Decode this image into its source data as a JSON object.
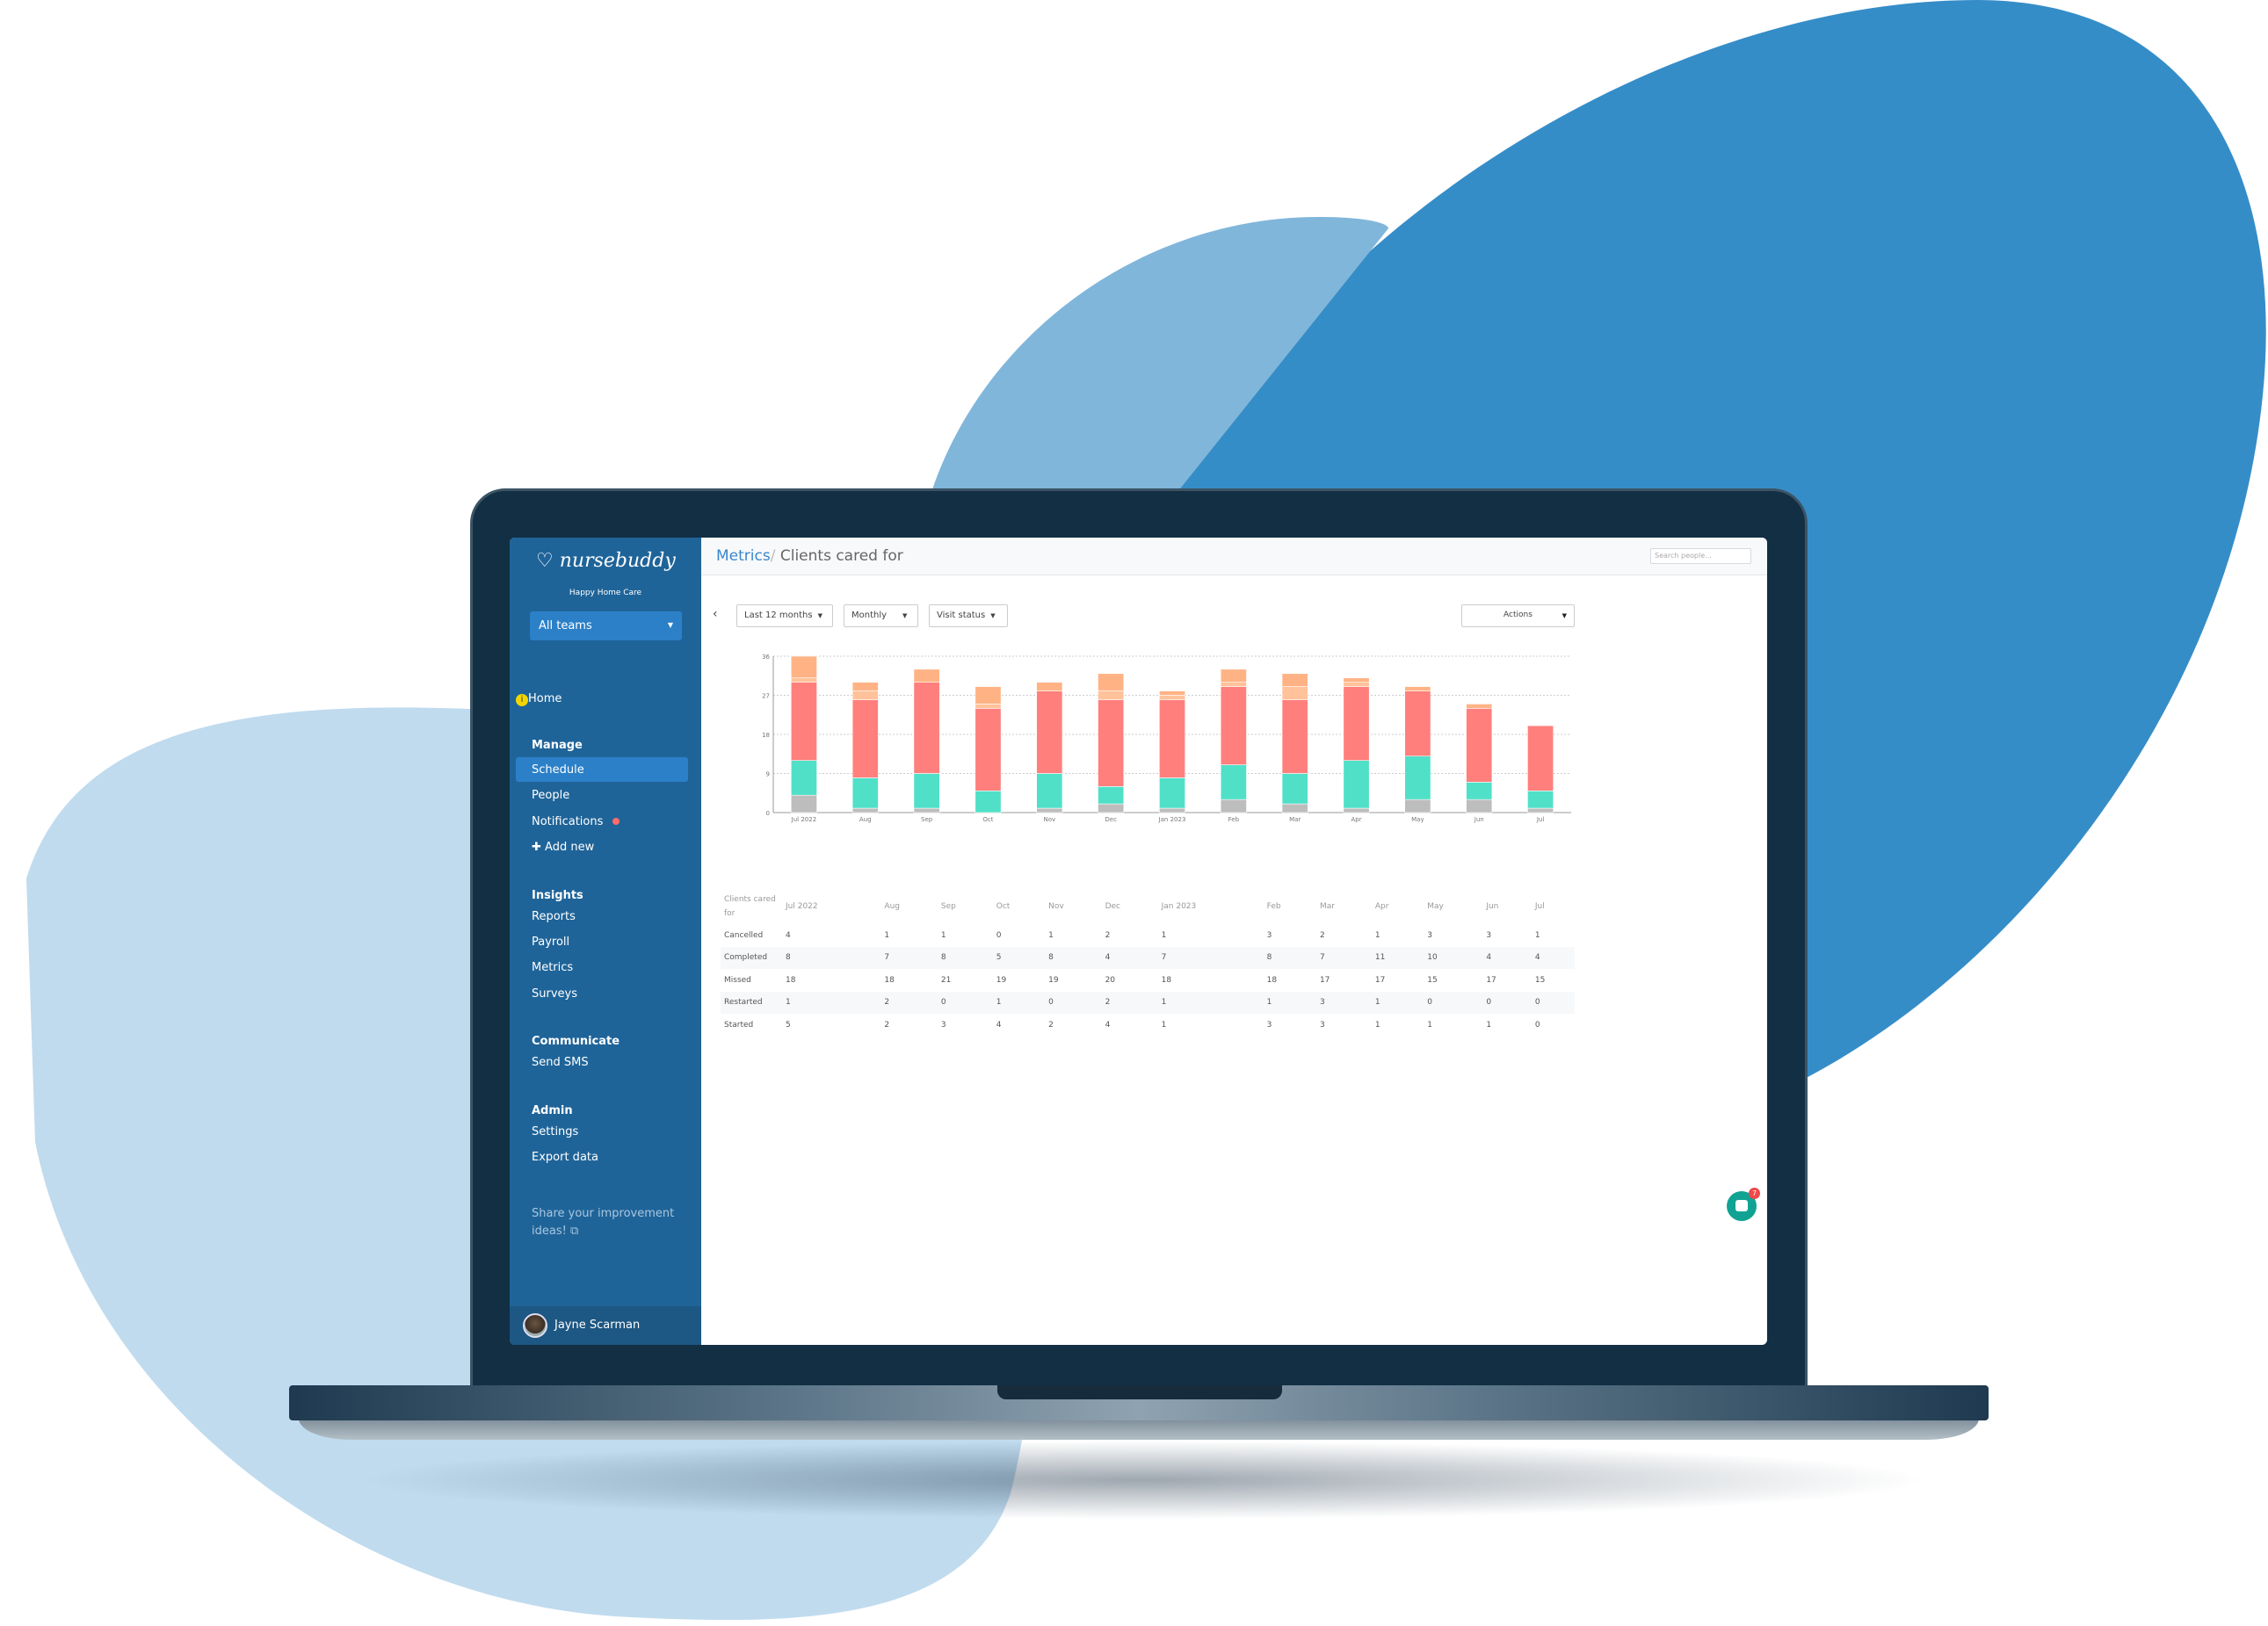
{
  "colors": {
    "blob_dark": "#358dc8",
    "blob_mid": "#81b6db",
    "blob_light": "#c0dbee",
    "sidebar": "#1f6499",
    "accent": "#2b80c8",
    "cancelled": "#bdbdbd",
    "completed": "#50e0c8",
    "missed": "#ff7f7c",
    "restarted": "#ffc29a",
    "started": "#ffb385"
  },
  "sidebar": {
    "brand": "nursebuddy",
    "org": "Happy Home Care",
    "team_select": "All teams",
    "home": "Home",
    "sections": [
      {
        "title": "Manage",
        "items": [
          "Schedule",
          "People",
          "Notifications",
          "Add new"
        ]
      },
      {
        "title": "Insights",
        "items": [
          "Reports",
          "Payroll",
          "Metrics",
          "Surveys"
        ]
      },
      {
        "title": "Communicate",
        "items": [
          "Send SMS"
        ]
      },
      {
        "title": "Admin",
        "items": [
          "Settings",
          "Export data"
        ]
      }
    ],
    "share": "Share your improvement ideas!",
    "user": "Jayne Scarman",
    "active": "Schedule"
  },
  "header": {
    "breadcrumb_parent": "Metrics",
    "breadcrumb_sep": "/",
    "title": "Clients cared for",
    "search_placeholder": "Search people..."
  },
  "filters": {
    "back": "‹",
    "range": "Last 12 months",
    "interval": "Monthly",
    "group": "Visit status",
    "actions": "Actions"
  },
  "chat": {
    "badge": "7"
  },
  "chart_data": {
    "type": "bar",
    "stacked": true,
    "ylim": [
      0,
      36
    ],
    "yticks": [
      "0",
      "9",
      "18",
      "27",
      "36"
    ],
    "grid": true,
    "categories": [
      "Jul 2022",
      "Aug",
      "Sep",
      "Oct",
      "Nov",
      "Dec",
      "Jan 2023",
      "Feb",
      "Mar",
      "Apr",
      "May",
      "Jun",
      "Jul"
    ],
    "series": [
      {
        "name": "Cancelled",
        "color": "#bdbdbd",
        "values": [
          4,
          1,
          1,
          0,
          1,
          2,
          1,
          3,
          2,
          1,
          3,
          3,
          1
        ]
      },
      {
        "name": "Completed",
        "color": "#50e0c8",
        "values": [
          8,
          7,
          8,
          5,
          8,
          4,
          7,
          8,
          7,
          11,
          10,
          4,
          4
        ]
      },
      {
        "name": "Missed",
        "color": "#ff7f7c",
        "values": [
          18,
          18,
          21,
          19,
          19,
          20,
          18,
          18,
          17,
          17,
          15,
          17,
          15
        ]
      },
      {
        "name": "Restarted",
        "color": "#ffc29a",
        "values": [
          1,
          2,
          0,
          1,
          0,
          2,
          1,
          1,
          3,
          1,
          0,
          0,
          0
        ]
      },
      {
        "name": "Started",
        "color": "#ffb385",
        "values": [
          5,
          2,
          3,
          4,
          2,
          4,
          1,
          3,
          3,
          1,
          1,
          1,
          0
        ]
      }
    ]
  },
  "table": {
    "corner": "Clients cared for"
  }
}
